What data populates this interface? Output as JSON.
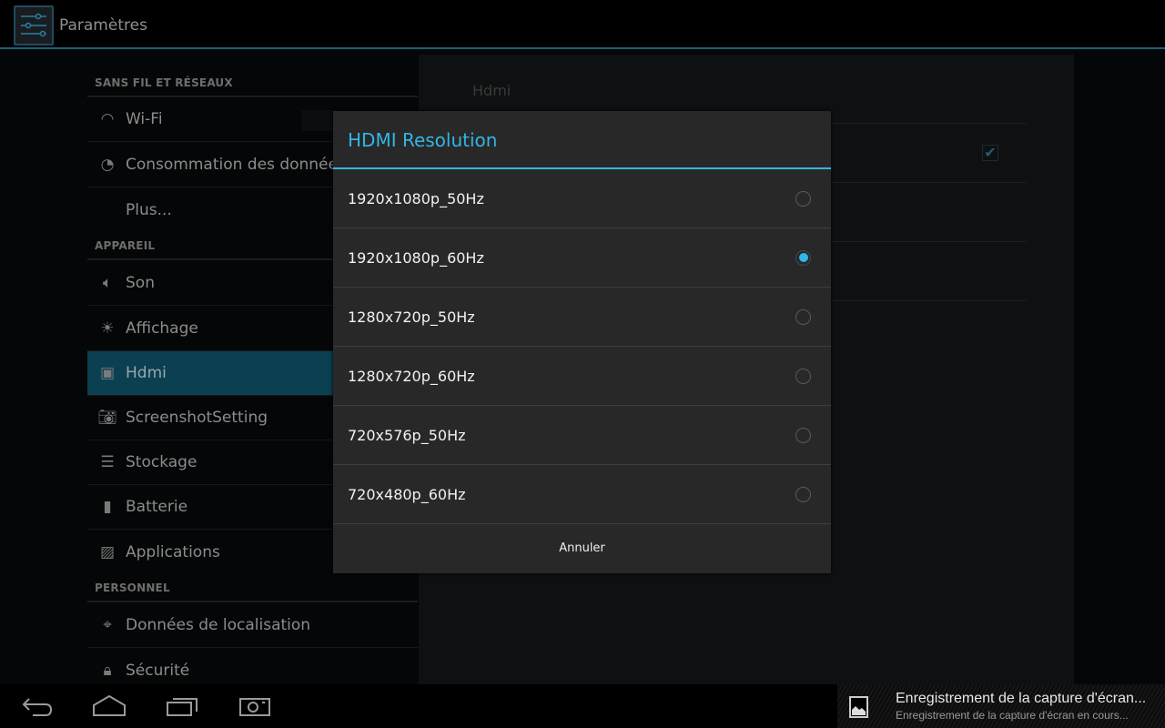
{
  "app": {
    "title": "Paramètres",
    "icon": "settings-sliders-icon"
  },
  "sidebar": {
    "sections": [
      {
        "header": "SANS FIL ET RÉSEAUX"
      },
      {
        "header": "APPAREIL"
      },
      {
        "header": "PERSONNEL"
      }
    ],
    "items": [
      {
        "label": "Wi-Fi",
        "icon": "wifi-icon"
      },
      {
        "label": "Consommation des données",
        "icon": "data-usage-icon"
      },
      {
        "label": "Plus...",
        "icon": ""
      },
      {
        "label": "Son",
        "icon": "speaker-icon"
      },
      {
        "label": "Affichage",
        "icon": "brightness-icon"
      },
      {
        "label": "Hdmi",
        "icon": "hdmi-monitor-icon",
        "selected": true
      },
      {
        "label": "ScreenshotSetting",
        "icon": "camera-icon"
      },
      {
        "label": "Stockage",
        "icon": "storage-icon"
      },
      {
        "label": "Batterie",
        "icon": "battery-icon"
      },
      {
        "label": "Applications",
        "icon": "apps-icon"
      },
      {
        "label": "Données de localisation",
        "icon": "location-icon"
      },
      {
        "label": "Sécurité",
        "icon": "lock-icon"
      }
    ]
  },
  "detail": {
    "header": "Hdmi",
    "checkbox_checked": true
  },
  "dialog": {
    "title": "HDMI Resolution",
    "options": [
      "1920x1080p_50Hz",
      "1920x1080p_60Hz",
      "1280x720p_50Hz",
      "1280x720p_60Hz",
      "720x576p_50Hz",
      "720x480p_60Hz"
    ],
    "selected": "1920x1080p_60Hz",
    "cancel": "Annuler",
    "accent": "#33b5e5"
  },
  "navbar": {
    "buttons": [
      "back-icon",
      "home-icon",
      "recent-apps-icon",
      "screenshot-icon"
    ]
  },
  "notification": {
    "title": "Enregistrement de la capture d'écran...",
    "text": "Enregistrement de la capture d'écran en cours...",
    "icon": "image-icon"
  }
}
